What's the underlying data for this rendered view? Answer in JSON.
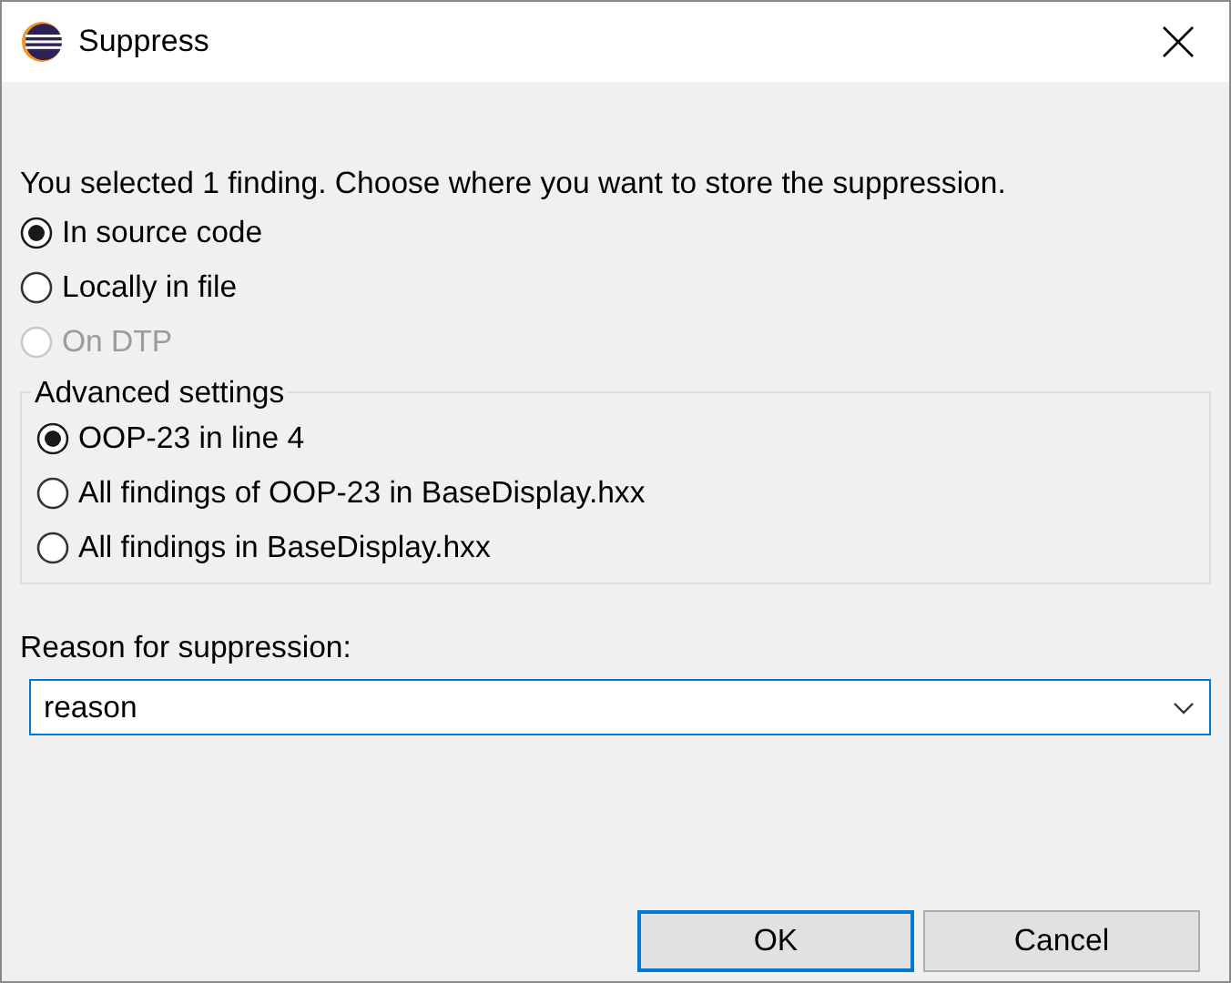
{
  "window": {
    "title": "Suppress"
  },
  "message": "You selected 1 finding. Choose where you want to store the suppression.",
  "storage_options": [
    {
      "label": "In source code",
      "selected": true,
      "disabled": false
    },
    {
      "label": "Locally in file",
      "selected": false,
      "disabled": false
    },
    {
      "label": "On DTP",
      "selected": false,
      "disabled": true
    }
  ],
  "advanced_settings": {
    "title": "Advanced settings",
    "options": [
      {
        "label": "OOP-23 in line 4",
        "selected": true
      },
      {
        "label": "All findings of OOP-23 in BaseDisplay.hxx",
        "selected": false
      },
      {
        "label": "All findings in BaseDisplay.hxx",
        "selected": false
      }
    ]
  },
  "reason": {
    "label": "Reason for suppression:",
    "value": "reason"
  },
  "buttons": [
    {
      "label": "OK",
      "default": true
    },
    {
      "label": "Cancel",
      "default": false
    }
  ]
}
